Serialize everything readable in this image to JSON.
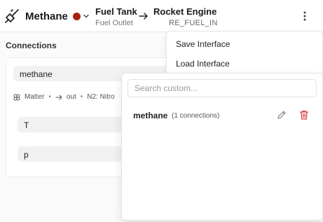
{
  "header": {
    "title": "Methane",
    "color": "#a8230f",
    "source": {
      "name": "Fuel Tank",
      "port": "Fuel Outlet"
    },
    "destination": {
      "name": "Rocket Engine",
      "port": "RE_FUEL_IN"
    },
    "icons": {
      "connection": "plug-icon",
      "expand": "chevron-down-icon",
      "arrow": "arrow-right-icon",
      "more": "kebab-menu-icon"
    }
  },
  "connections": {
    "title": "Connections",
    "item": {
      "name": "methane",
      "meta": {
        "type": "Matter",
        "direction": "out",
        "medium": "N2: Nitro"
      },
      "fields": [
        "T",
        "p"
      ]
    }
  },
  "menu": {
    "items": [
      "Save Interface",
      "Load Interface"
    ]
  },
  "submenu": {
    "search_placeholder": "Search custom...",
    "items": [
      {
        "name": "methane",
        "count": "(1 connections)"
      }
    ],
    "colors": {
      "delete": "#d64040"
    }
  }
}
